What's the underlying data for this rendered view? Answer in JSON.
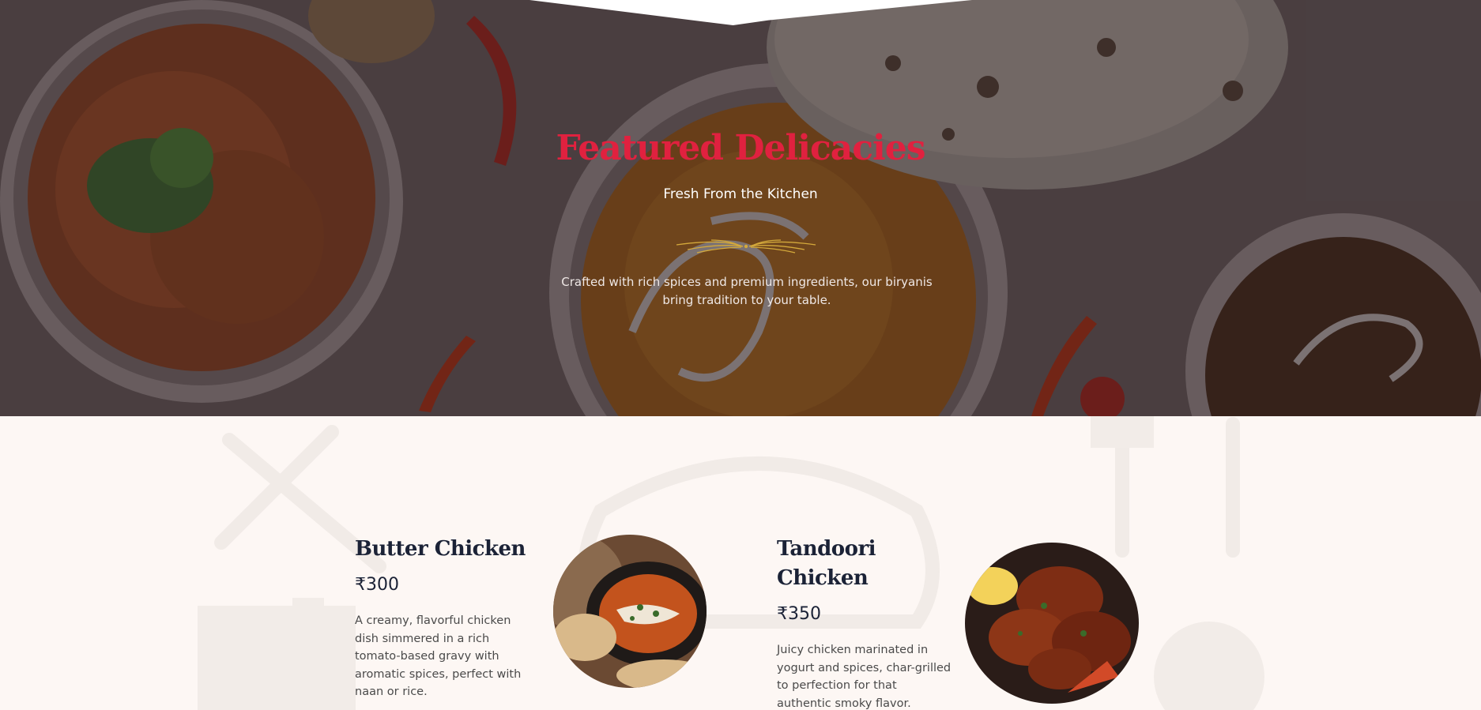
{
  "hero": {
    "title": "Featured Delicacies",
    "subtitle": "Fresh From the Kitchen",
    "description": "Crafted with rich spices and premium ingredients, our biryanis bring tradition to your table.",
    "divider_icon": "ornamental-flourish-icon"
  },
  "menu": {
    "items": [
      {
        "name": "Butter Chicken",
        "price": "₹300",
        "description": "A creamy, flavorful chicken dish simmered in a rich tomato-based gravy with aromatic spices, perfect with naan or rice.",
        "photo": "butter-chicken-photo"
      },
      {
        "name": "Tandoori Chicken",
        "price": "₹350",
        "description": "Juicy chicken marinated in yogurt and spices, char-grilled to perfection for that authentic smoky flavor.",
        "photo": "tandoori-chicken-photo"
      }
    ]
  },
  "colors": {
    "accent": "#e0213f",
    "heading_dark": "#1b2236",
    "section_bg": "#fdf7f4",
    "gold": "#d4a93b"
  }
}
